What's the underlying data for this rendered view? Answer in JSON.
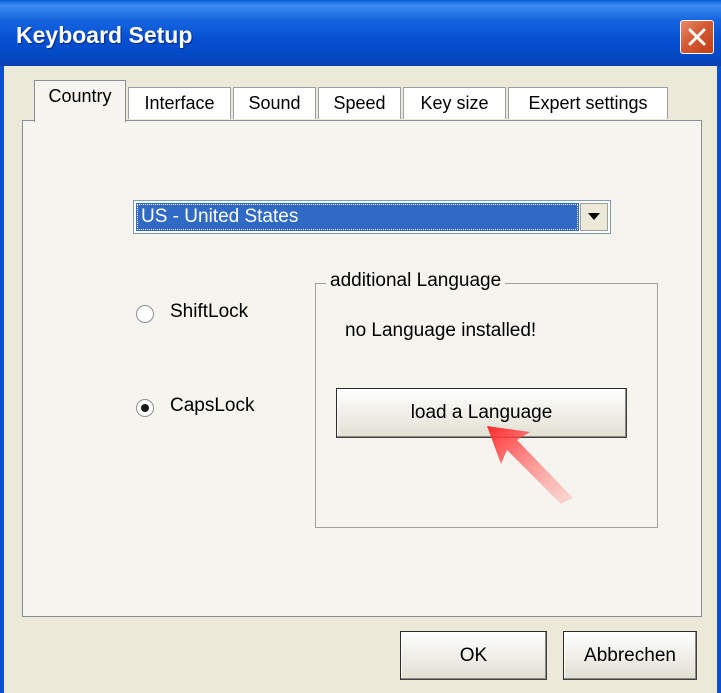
{
  "window": {
    "title": "Keyboard Setup",
    "close_icon": "close-x-icon"
  },
  "tabs": [
    {
      "label": "Country",
      "active": true
    },
    {
      "label": "Interface",
      "active": false
    },
    {
      "label": "Sound",
      "active": false
    },
    {
      "label": "Speed",
      "active": false
    },
    {
      "label": "Key size",
      "active": false
    },
    {
      "label": "Expert settings",
      "active": false
    }
  ],
  "country": {
    "selected": "US - United States"
  },
  "lock_mode": {
    "options": [
      {
        "label": "ShiftLock",
        "checked": false
      },
      {
        "label": "CapsLock",
        "checked": true
      }
    ]
  },
  "additional_language": {
    "legend": "additional Language",
    "status": "no Language installed!",
    "load_button": "load a Language"
  },
  "footer": {
    "ok_label": "OK",
    "cancel_label": "Abbrechen"
  },
  "colors": {
    "titlebar": "#0450d2",
    "selection": "#316ac5",
    "annotation_arrow": "#e8242a"
  }
}
